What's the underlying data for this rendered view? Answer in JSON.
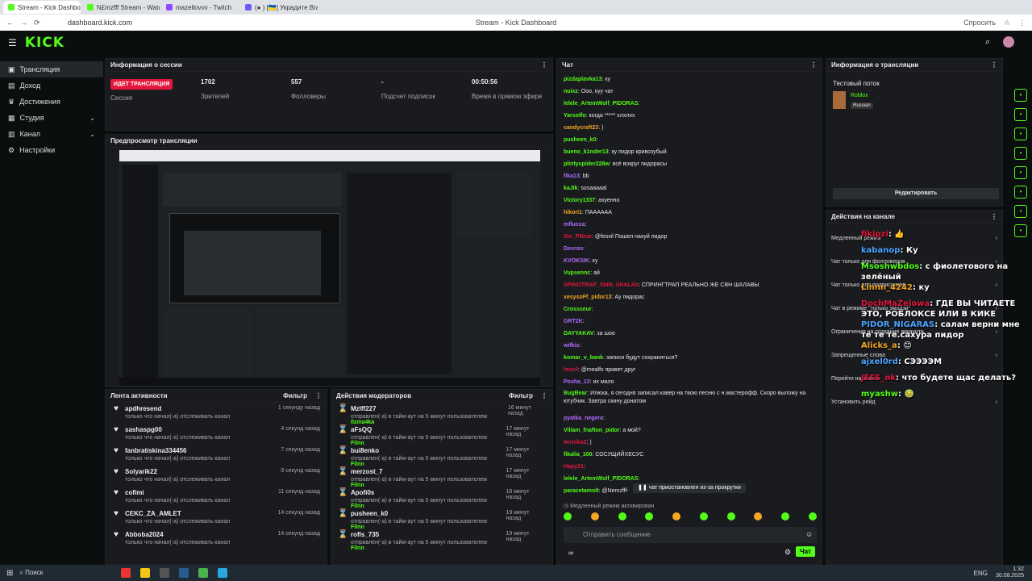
{
  "browser": {
    "tabs": [
      {
        "title": "Stream - Kick Dashboard",
        "active": true
      },
      {
        "title": "N£mzfff Stream - Watch Li",
        "active": false
      },
      {
        "title": "mazellovvv - Twitch",
        "active": false
      },
      {
        "title": "(● ) [🇺🇦] Украдите Brainro",
        "active": false
      }
    ],
    "url": "dashboard.kick.com",
    "page_title": "Stream - Kick Dashboard",
    "share": "Спросить"
  },
  "topbar": {
    "logo": "KICK"
  },
  "sidebar": {
    "items": [
      {
        "label": "Трансляция",
        "icon": "video-icon",
        "active": true,
        "chev": false
      },
      {
        "label": "Доход",
        "icon": "money-icon",
        "active": false,
        "chev": false
      },
      {
        "label": "Достижения",
        "icon": "trophy-icon",
        "active": false,
        "chev": false
      },
      {
        "label": "Студия",
        "icon": "studio-icon",
        "active": false,
        "chev": true
      },
      {
        "label": "Канал",
        "icon": "channel-icon",
        "active": false,
        "chev": true
      },
      {
        "label": "Настройки",
        "icon": "gear-icon",
        "active": false,
        "chev": false
      }
    ]
  },
  "session": {
    "title": "Информация о сессии",
    "live_label": "ИДЕТ ТРАНСЛЯЦИЯ",
    "session_label": "Сессия",
    "stats": [
      {
        "value": "1702",
        "label": "Зрителей"
      },
      {
        "value": "557",
        "label": "Фолловеры"
      },
      {
        "value": "-",
        "label": "Подсчет подписок"
      },
      {
        "value": "00:50:56",
        "label": "Время в прямом эфире"
      }
    ]
  },
  "preview": {
    "title": "Предпросмотр трансляции"
  },
  "activity": {
    "title": "Лента активности",
    "filter": "Фильтр",
    "items": [
      {
        "name": "apdhresend",
        "text": "только что начал(-а) отслеживать канал",
        "time": "1 секунду назад"
      },
      {
        "name": "sashaspg00",
        "text": "только что начал(-а) отслеживать канал",
        "time": "4 секунд назад"
      },
      {
        "name": "fanbratiskina334456",
        "text": "только что начал(-а) отслеживать канал",
        "time": "7 секунд назад"
      },
      {
        "name": "Solyarik22",
        "text": "только что начал(-а) отслеживать канал",
        "time": "9 секунд назад"
      },
      {
        "name": "cofimi",
        "text": "только что начал(-а) отслеживать канал",
        "time": "11 секунд назад"
      },
      {
        "name": "CEKC_ZA_AMLET",
        "text": "только что начал(-а) отслеживать канал",
        "time": "14 секунд назад"
      },
      {
        "name": "Abboba2024",
        "text": "только что начал(-а) отслеживать канал",
        "time": "14 секунд назад"
      }
    ]
  },
  "mod_actions": {
    "title": "Действия модераторов",
    "filter": "Фильтр",
    "items": [
      {
        "name": "Mzlff227",
        "text": "отправлен(-а) в тайм-аут на 5 минут пользователем",
        "mod": "Ilzma4ka",
        "time": "16 минут назад"
      },
      {
        "name": "aFsQQ",
        "text": "отправлен(-а) в тайм-аут на 5 минут пользователем",
        "mod": "Filnn",
        "time": "17 минут назад"
      },
      {
        "name": "bui8enko",
        "text": "отправлен(-а) в тайм-аут на 5 минут пользователем",
        "mod": "Filnn",
        "time": "17 минут назад"
      },
      {
        "name": "merzost_7",
        "text": "отправлен(-а) в тайм-аут на 5 минут пользователем",
        "mod": "Filnn",
        "time": "17 минут назад"
      },
      {
        "name": "Apofi0s",
        "text": "отправлен(-а) в тайм-аут на 5 минут пользователем",
        "mod": "Filnn",
        "time": "18 минут назад"
      },
      {
        "name": "pusheen_k0",
        "text": "отправлен(-а) в тайм-аут на 5 минут пользователем",
        "mod": "Filnn",
        "time": "19 минут назад"
      },
      {
        "name": "rofls_735",
        "text": "отправлен(-а) в тайм-аут на 5 минут пользователем",
        "mod": "Filnn",
        "time": "19 минут назад"
      }
    ]
  },
  "chat": {
    "title": "Чат",
    "messages": [
      {
        "user": "pizdaplavka13",
        "color": "#53fc18",
        "text": "ку"
      },
      {
        "user": "nuixz",
        "color": "#53fc18",
        "text": "Ооо, куу чат"
      },
      {
        "user": "lelele_ArtemWolf_PIDORAS",
        "color": "#53fc18",
        "text": ""
      },
      {
        "user": "Yarsolfo",
        "color": "#53fc18",
        "text": "когда ***** хлхлхх"
      },
      {
        "user": "candycraft23",
        "color": "#f5a623",
        "text": ")"
      },
      {
        "user": "pusheen_k0",
        "color": "#53fc18",
        "text": ""
      },
      {
        "user": "bueno_k1nder13",
        "color": "#53fc18",
        "text": "ку пидор кривозубый"
      },
      {
        "user": "plintyspider228w",
        "color": "#53fc18",
        "text": "всё вокруг пидорасы"
      },
      {
        "user": "fika13",
        "color": "#b36bff",
        "text": "bb"
      },
      {
        "user": "kaJIk",
        "color": "#53fc18",
        "text": "sosaaaaal"
      },
      {
        "user": "Victory1337",
        "color": "#53fc18",
        "text": "ахуенно"
      },
      {
        "user": "hikori1",
        "color": "#f5a623",
        "text": "ПАААААА"
      },
      {
        "user": "mflucca",
        "color": "#b36bff",
        "text": ""
      },
      {
        "user": "Sin_PNear",
        "color": "#e3163c",
        "text": "@fesvil Пошел нахуй пидор"
      },
      {
        "user": "Decron",
        "color": "#b36bff",
        "text": ""
      },
      {
        "user": "KVOKSIK",
        "color": "#b36bff",
        "text": "ку"
      },
      {
        "user": "Vupsennc",
        "color": "#53fc18",
        "text": "ай"
      },
      {
        "user": "SPINGTRAP_SbIN_SHALAb",
        "color": "#e3163c",
        "text": "СПРИНГТРАП РЕАЛЬНО ЖЕ СВН ШАЛАВЫ"
      },
      {
        "user": "xesysoFf_pidor13",
        "color": "#f5a623",
        "text": "Ау пидорас"
      },
      {
        "user": "Crossseur",
        "color": "#53fc18",
        "text": ""
      },
      {
        "user": "GRT2K",
        "color": "#b36bff",
        "text": ""
      },
      {
        "user": "DAYYAKAV",
        "color": "#53fc18",
        "text": "за шоо"
      },
      {
        "user": "wifkis",
        "color": "#b36bff",
        "text": ""
      },
      {
        "user": "komar_v_bank",
        "color": "#53fc18",
        "text": "записи будут сохраняться?"
      },
      {
        "user": "fesvil",
        "color": "#e3163c",
        "text": "@mealfx привет друг"
      },
      {
        "user": "Posha_13",
        "color": "#b36bff",
        "text": "их мало"
      },
      {
        "user": "BugBear",
        "color": "#53fc18",
        "text": "Илюха, я сегодня записал кавер на твою песню с н.мастерофф. Скоро выложу на ютубчик. Завтра скину донатом"
      },
      {
        "user": "pyatka_negera",
        "color": "#b36bff",
        "text": ""
      },
      {
        "user": "Viliam_fnafton_pidor",
        "color": "#53fc18",
        "text": "а мой?"
      },
      {
        "user": "4ernika2",
        "color": "#e3163c",
        "text": ")"
      },
      {
        "user": "fikalia_100",
        "color": "#53fc18",
        "text": "СОСУЩИЙХЕСУС"
      },
      {
        "user": "Hapy21",
        "color": "#e3163c",
        "text": ""
      },
      {
        "user": "lelele_ArtemWolf_PIDORAS",
        "color": "#53fc18",
        "text": ""
      },
      {
        "user": "paracetamolt",
        "color": "#53fc18",
        "text": "@Nemzfff-"
      }
    ],
    "paused": "чат приостановлен из-за прокрутки",
    "slow_mode": "Медленный режим активирован",
    "input_placeholder": "Отправить сообщение",
    "send": "Чат",
    "viewers_icon_label": "∞"
  },
  "stream_info": {
    "title": "Информация о трансляции",
    "stream_title": "Тестовый поток",
    "category": "Roblox",
    "language": "Russian",
    "edit": "Редактировать"
  },
  "channel_actions": {
    "title": "Действия на канале",
    "rows": [
      "Медленный режим",
      "Чат только для фолловеров",
      "Чат только для подписчиков",
      "Чат в режиме \"только эмодзи\"",
      "Ограничения на создание аккаунта",
      "Запрещенные слова",
      "Перейти на канал",
      "Установить рейд"
    ]
  },
  "overlay": [
    {
      "user": "fikipzi",
      "color": "#e3163c",
      "text": "👍"
    },
    {
      "user": "kabanop",
      "color": "#4aa3ff",
      "text": "Ку"
    },
    {
      "user": "Msoshwbdos",
      "color": "#53fc18",
      "text": "с фиолетового на зелёный"
    },
    {
      "user": "Linnn_4242",
      "color": "#f5a623",
      "text": "ку"
    },
    {
      "user": "DochMaZelowa",
      "color": "#e3163c",
      "text": "ГДЕ ВЫ ЧИТАЕТЕ ЭТО, РОБЛОКСЕ ИЛИ В КИКЕ"
    },
    {
      "user": "PIDOR_NIGARAS",
      "color": "#4aa3ff",
      "text": "салам верни мне те те те.сахура пидор"
    },
    {
      "user": "Alicks_a",
      "color": "#f5a623",
      "text": "😊"
    },
    {
      "user": "ajxel0rd",
      "color": "#4aa3ff",
      "text": "СЭЭЭЭМ"
    },
    {
      "user": "JESS_ok",
      "color": "#e3163c",
      "text": "что будете щас делать?"
    },
    {
      "user": "myashw",
      "color": "#53fc18",
      "text": "🤢"
    }
  ],
  "taskbar": {
    "search": "Поиск",
    "lang": "ENG",
    "time": "1:32",
    "date": "30.08.2025"
  }
}
